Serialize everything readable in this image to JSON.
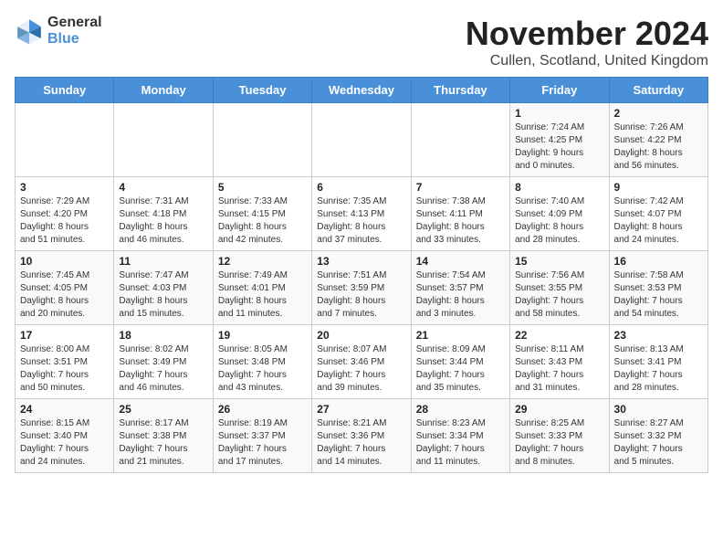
{
  "logo": {
    "general": "General",
    "blue": "Blue"
  },
  "title": "November 2024",
  "location": "Cullen, Scotland, United Kingdom",
  "weekdays": [
    "Sunday",
    "Monday",
    "Tuesday",
    "Wednesday",
    "Thursday",
    "Friday",
    "Saturday"
  ],
  "weeks": [
    [
      {
        "day": "",
        "info": ""
      },
      {
        "day": "",
        "info": ""
      },
      {
        "day": "",
        "info": ""
      },
      {
        "day": "",
        "info": ""
      },
      {
        "day": "",
        "info": ""
      },
      {
        "day": "1",
        "info": "Sunrise: 7:24 AM\nSunset: 4:25 PM\nDaylight: 9 hours\nand 0 minutes."
      },
      {
        "day": "2",
        "info": "Sunrise: 7:26 AM\nSunset: 4:22 PM\nDaylight: 8 hours\nand 56 minutes."
      }
    ],
    [
      {
        "day": "3",
        "info": "Sunrise: 7:29 AM\nSunset: 4:20 PM\nDaylight: 8 hours\nand 51 minutes."
      },
      {
        "day": "4",
        "info": "Sunrise: 7:31 AM\nSunset: 4:18 PM\nDaylight: 8 hours\nand 46 minutes."
      },
      {
        "day": "5",
        "info": "Sunrise: 7:33 AM\nSunset: 4:15 PM\nDaylight: 8 hours\nand 42 minutes."
      },
      {
        "day": "6",
        "info": "Sunrise: 7:35 AM\nSunset: 4:13 PM\nDaylight: 8 hours\nand 37 minutes."
      },
      {
        "day": "7",
        "info": "Sunrise: 7:38 AM\nSunset: 4:11 PM\nDaylight: 8 hours\nand 33 minutes."
      },
      {
        "day": "8",
        "info": "Sunrise: 7:40 AM\nSunset: 4:09 PM\nDaylight: 8 hours\nand 28 minutes."
      },
      {
        "day": "9",
        "info": "Sunrise: 7:42 AM\nSunset: 4:07 PM\nDaylight: 8 hours\nand 24 minutes."
      }
    ],
    [
      {
        "day": "10",
        "info": "Sunrise: 7:45 AM\nSunset: 4:05 PM\nDaylight: 8 hours\nand 20 minutes."
      },
      {
        "day": "11",
        "info": "Sunrise: 7:47 AM\nSunset: 4:03 PM\nDaylight: 8 hours\nand 15 minutes."
      },
      {
        "day": "12",
        "info": "Sunrise: 7:49 AM\nSunset: 4:01 PM\nDaylight: 8 hours\nand 11 minutes."
      },
      {
        "day": "13",
        "info": "Sunrise: 7:51 AM\nSunset: 3:59 PM\nDaylight: 8 hours\nand 7 minutes."
      },
      {
        "day": "14",
        "info": "Sunrise: 7:54 AM\nSunset: 3:57 PM\nDaylight: 8 hours\nand 3 minutes."
      },
      {
        "day": "15",
        "info": "Sunrise: 7:56 AM\nSunset: 3:55 PM\nDaylight: 7 hours\nand 58 minutes."
      },
      {
        "day": "16",
        "info": "Sunrise: 7:58 AM\nSunset: 3:53 PM\nDaylight: 7 hours\nand 54 minutes."
      }
    ],
    [
      {
        "day": "17",
        "info": "Sunrise: 8:00 AM\nSunset: 3:51 PM\nDaylight: 7 hours\nand 50 minutes."
      },
      {
        "day": "18",
        "info": "Sunrise: 8:02 AM\nSunset: 3:49 PM\nDaylight: 7 hours\nand 46 minutes."
      },
      {
        "day": "19",
        "info": "Sunrise: 8:05 AM\nSunset: 3:48 PM\nDaylight: 7 hours\nand 43 minutes."
      },
      {
        "day": "20",
        "info": "Sunrise: 8:07 AM\nSunset: 3:46 PM\nDaylight: 7 hours\nand 39 minutes."
      },
      {
        "day": "21",
        "info": "Sunrise: 8:09 AM\nSunset: 3:44 PM\nDaylight: 7 hours\nand 35 minutes."
      },
      {
        "day": "22",
        "info": "Sunrise: 8:11 AM\nSunset: 3:43 PM\nDaylight: 7 hours\nand 31 minutes."
      },
      {
        "day": "23",
        "info": "Sunrise: 8:13 AM\nSunset: 3:41 PM\nDaylight: 7 hours\nand 28 minutes."
      }
    ],
    [
      {
        "day": "24",
        "info": "Sunrise: 8:15 AM\nSunset: 3:40 PM\nDaylight: 7 hours\nand 24 minutes."
      },
      {
        "day": "25",
        "info": "Sunrise: 8:17 AM\nSunset: 3:38 PM\nDaylight: 7 hours\nand 21 minutes."
      },
      {
        "day": "26",
        "info": "Sunrise: 8:19 AM\nSunset: 3:37 PM\nDaylight: 7 hours\nand 17 minutes."
      },
      {
        "day": "27",
        "info": "Sunrise: 8:21 AM\nSunset: 3:36 PM\nDaylight: 7 hours\nand 14 minutes."
      },
      {
        "day": "28",
        "info": "Sunrise: 8:23 AM\nSunset: 3:34 PM\nDaylight: 7 hours\nand 11 minutes."
      },
      {
        "day": "29",
        "info": "Sunrise: 8:25 AM\nSunset: 3:33 PM\nDaylight: 7 hours\nand 8 minutes."
      },
      {
        "day": "30",
        "info": "Sunrise: 8:27 AM\nSunset: 3:32 PM\nDaylight: 7 hours\nand 5 minutes."
      }
    ]
  ]
}
